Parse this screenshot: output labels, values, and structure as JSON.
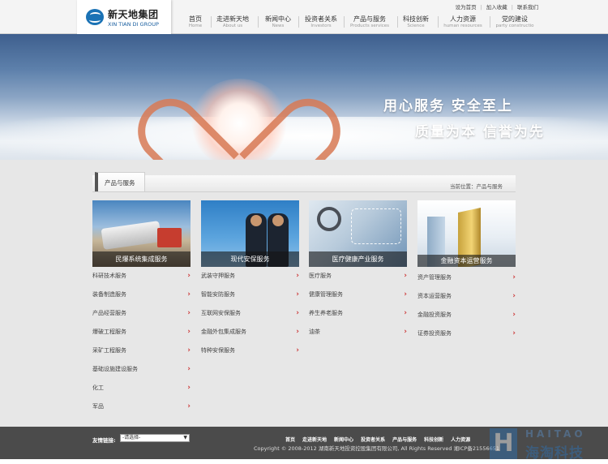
{
  "header": {
    "logo_cn": "新天地集团",
    "logo_en": "XIN TIAN DI GROUP",
    "top_links": [
      "设为首页",
      "加入收藏",
      "联系我们"
    ]
  },
  "nav": [
    {
      "cn": "首页",
      "en": "Home"
    },
    {
      "cn": "走进新天地",
      "en": "About us"
    },
    {
      "cn": "新闻中心",
      "en": "News"
    },
    {
      "cn": "投资者关系",
      "en": "Investors"
    },
    {
      "cn": "产品与服务",
      "en": "Products services"
    },
    {
      "cn": "科技创新",
      "en": "Science"
    },
    {
      "cn": "人力资源",
      "en": "human resources"
    },
    {
      "cn": "党的建设",
      "en": "party constructio"
    }
  ],
  "banner": {
    "slogan1": "用心服务  安全至上",
    "slogan2": "质量为本  信誉为先"
  },
  "section": {
    "tab": "产品与服务",
    "breadcrumb": "当前位置：产品与服务"
  },
  "cards": [
    {
      "caption": "民爆系统集成服务",
      "items": [
        "科研技术服务",
        "装备制造服务",
        "产品经营服务",
        "爆破工程服务",
        "采矿工程服务",
        "基础设施建设服务",
        "化工",
        "军品"
      ]
    },
    {
      "caption": "现代安保服务",
      "items": [
        "武装守押服务",
        "智能安防服务",
        "互联网安保服务",
        "金融外包集成服务",
        "特种安保服务"
      ]
    },
    {
      "caption": "医疗健康产业服务",
      "items": [
        "医疗服务",
        "健康管理服务",
        "养生养老服务",
        "油茶"
      ]
    },
    {
      "caption": "金融资本运营服务",
      "items": [
        "资产管理服务",
        "资本运营服务",
        "金融投资服务",
        "证券投资服务"
      ]
    }
  ],
  "footer": {
    "friend_links_label": "友情链接:",
    "select_value": "-请选择-",
    "nav": [
      "首页",
      "走进新天地",
      "新闻中心",
      "投资者关系",
      "产品与服务",
      "科技创新",
      "人力资源"
    ],
    "copyright": "Copyright © 2008-2012 湖南新天地投资控股集团有限公司, All Rights Reserved   湘ICP备21556651"
  },
  "watermark": {
    "box": "H",
    "en": "HAITAO",
    "cn": "海淘科技"
  }
}
